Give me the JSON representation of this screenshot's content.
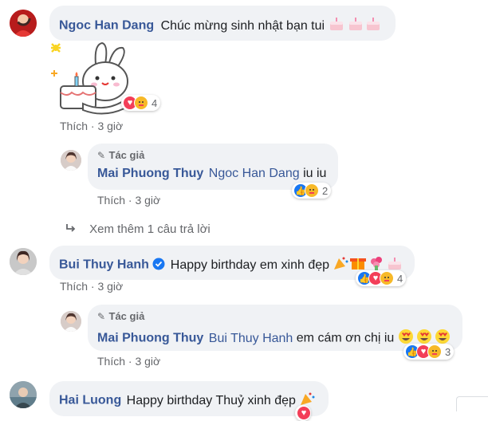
{
  "comments": [
    {
      "name": "Ngoc Han Dang",
      "text": "Chúc mừng sinh nhật bạn tui",
      "reaction_count": "4",
      "action": "Thích",
      "time": "3 giờ"
    },
    {
      "author_badge": "Tác giả",
      "name": "Mai Phuong Thuy",
      "tag": "Ngoc Han Dang",
      "text": "iu iu",
      "reaction_count": "2",
      "action": "Thích",
      "time": "3 giờ"
    },
    {
      "more_replies": "Xem thêm 1 câu trả lời"
    },
    {
      "name": "Bui Thuy Hanh",
      "text": "Happy birthday em xinh đẹp",
      "reaction_count": "4",
      "action": "Thích",
      "time": "3 giờ"
    },
    {
      "author_badge": "Tác giả",
      "name": "Mai Phuong Thuy",
      "tag": "Bui Thuy Hanh",
      "text": "em cám ơn chị iu",
      "reaction_count": "3",
      "action": "Thích",
      "time": "3 giờ"
    },
    {
      "name": "Hai Luong",
      "text": "Happy birthday Thuỷ xinh đẹp"
    }
  ],
  "colors": {
    "link_blue": "#385898",
    "like_blue": "#1877f2",
    "love_red": "#f33e58",
    "bubble": "#f0f2f5"
  }
}
